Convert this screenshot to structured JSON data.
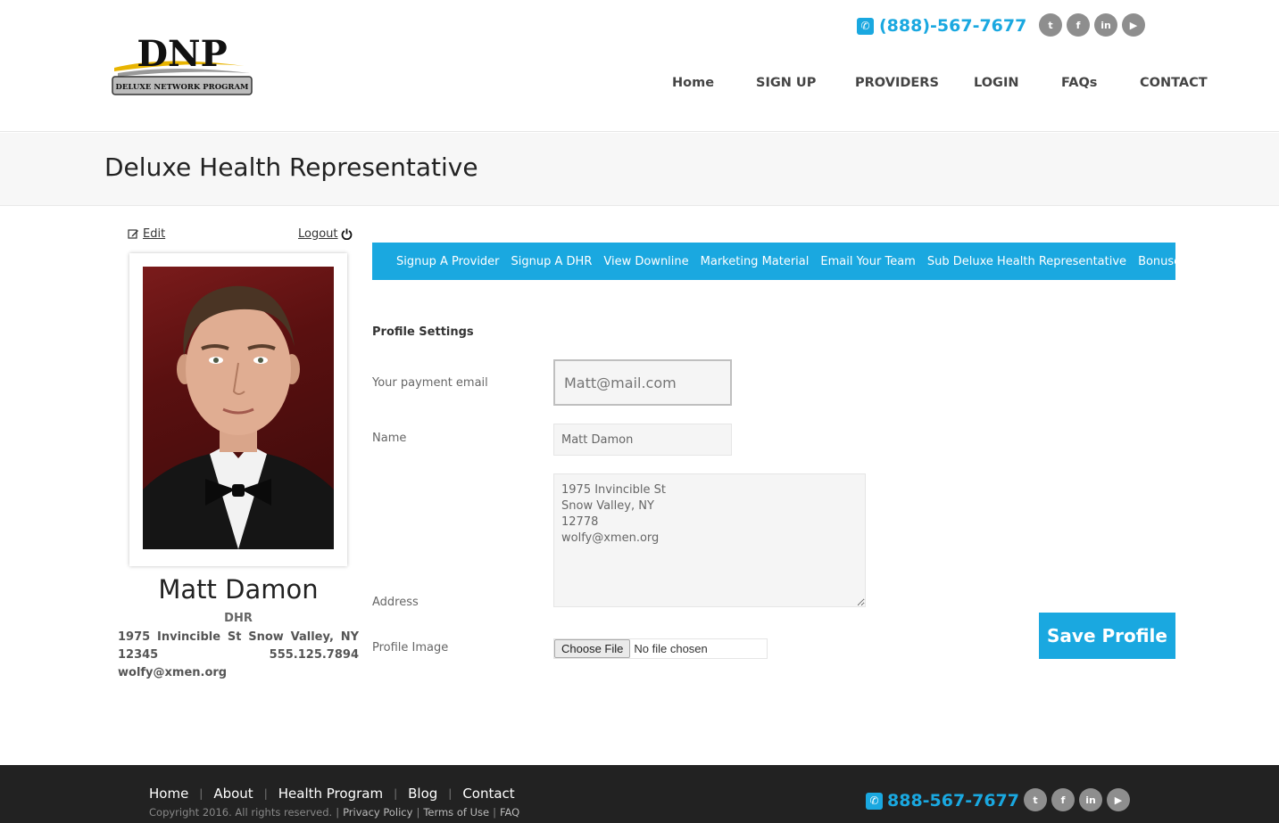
{
  "header": {
    "logo": {
      "title": "DNP",
      "subtitle": "DELUXE NETWORK PROGRAM"
    },
    "phone": "(888)-567-7677",
    "socials": [
      "twitter-icon",
      "facebook-icon",
      "linkedin-icon",
      "youtube-icon"
    ],
    "social_glyphs": [
      "t",
      "f",
      "in",
      "▶"
    ],
    "nav": [
      "Home",
      "SIGN UP",
      "PROVIDERS",
      "LOGIN",
      "FAQs",
      "CONTACT"
    ]
  },
  "page": {
    "title": "Deluxe Health Representative"
  },
  "profile": {
    "edit_label": "Edit",
    "logout_label": "Logout",
    "name": "Matt Damon",
    "role": "DHR",
    "address_line": "1975 Invincible St Snow Valley, NY 12345 555.125.7894 wolfy@xmen.org"
  },
  "menu": [
    "Signup A Provider",
    "Signup A DHR",
    "View Downline",
    "Marketing Material",
    "Email Your Team",
    "Sub Deluxe Health Representative",
    "Bonuses"
  ],
  "form": {
    "section_title": "Profile Settings",
    "email_label": "Your payment email",
    "email_placeholder": "Matt@mail.com",
    "name_label": "Name",
    "name_value": "Matt Damon",
    "address_label": "Address",
    "address_value": "1975 Invincible St\nSnow Valley, NY\n12778\nwolfy@xmen.org",
    "image_label": "Profile Image",
    "file_button": "Choose File",
    "file_status": "No file chosen",
    "save_label": "Save Profile"
  },
  "footer": {
    "nav": [
      "Home",
      "About",
      "Health Program",
      "Blog",
      "Contact"
    ],
    "separator": "|",
    "copyright": "Copyright 2016. All rights reserved.",
    "links": [
      "Privacy Policy",
      "Terms of Use",
      "FAQ"
    ],
    "phone": "888-567-7677"
  },
  "colors": {
    "accent": "#1aa8e0",
    "footer_bg": "#222222",
    "band_bg": "#f7f7f7"
  }
}
